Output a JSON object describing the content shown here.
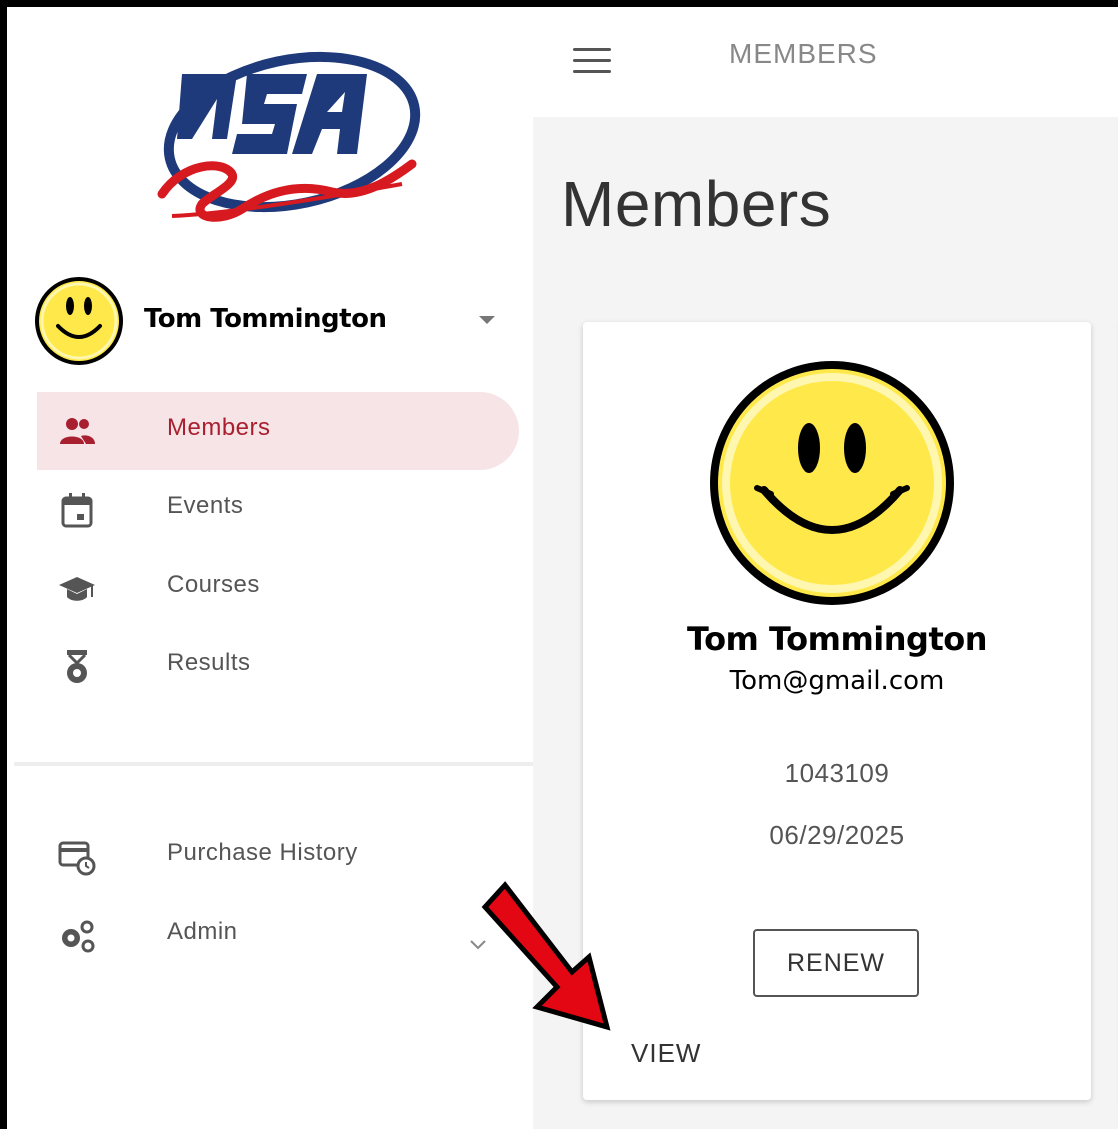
{
  "topbar": {
    "title": "MEMBERS"
  },
  "page": {
    "title": "Members"
  },
  "user": {
    "name": "Tom Tommington"
  },
  "sidebar": {
    "items": [
      {
        "label": "Members",
        "icon": "group-icon",
        "active": true
      },
      {
        "label": "Events",
        "icon": "calendar-icon"
      },
      {
        "label": "Courses",
        "icon": "graduation-cap-icon"
      },
      {
        "label": "Results",
        "icon": "medal-icon"
      },
      {
        "label": "Purchase History",
        "icon": "card-history-icon"
      },
      {
        "label": "Admin",
        "icon": "gears-icon"
      }
    ]
  },
  "card": {
    "name": "Tom Tommington",
    "email": "Tom@gmail.com",
    "member_id": "1043109",
    "expiration": "06/29/2025",
    "renew_label": "RENEW",
    "view_label": "VIEW"
  },
  "colors": {
    "accent": "#a8202f",
    "active_bg": "#f6e4e6",
    "arrow": "#e30613"
  }
}
